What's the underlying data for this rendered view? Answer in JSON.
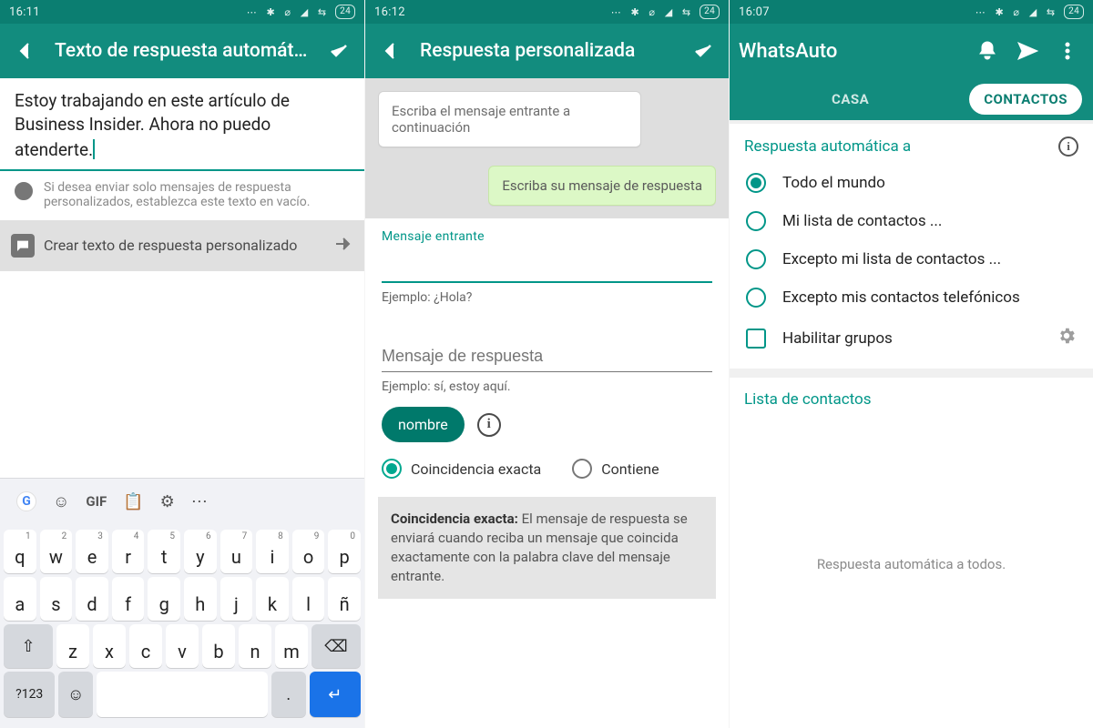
{
  "panel1": {
    "status_time": "16:11",
    "status_icons": "⋯ ✱ ⌀ ◢ ⇆",
    "battery": "24",
    "title": "Texto de respuesta automát…",
    "message": "Estoy trabajando en este artículo de Business Insider. Ahora no puedo atenderte.",
    "hint": "Si desea enviar solo mensajes de respuesta personalizados, establezca este texto en vacío.",
    "create_button": "Crear texto de respuesta personalizado",
    "keyboard": {
      "gif": "GIF",
      "row1": [
        "q",
        "w",
        "e",
        "r",
        "t",
        "y",
        "u",
        "i",
        "o",
        "p"
      ],
      "row1_sup": [
        "1",
        "2",
        "3",
        "4",
        "5",
        "6",
        "7",
        "8",
        "9",
        "0"
      ],
      "row2": [
        "a",
        "s",
        "d",
        "f",
        "g",
        "h",
        "j",
        "k",
        "l",
        "ñ"
      ],
      "row3": [
        "z",
        "x",
        "c",
        "v",
        "b",
        "n",
        "m"
      ],
      "sym": "?123"
    }
  },
  "panel2": {
    "status_time": "16:12",
    "battery": "24",
    "title": "Respuesta personalizada",
    "bubble_in": "Escriba el mensaje entrante a continuación",
    "bubble_out": "Escriba su mensaje de respuesta",
    "section1_title": "Mensaje entrante",
    "example1": "Ejemplo: ¿Hola?",
    "reply_placeholder": "Mensaje de respuesta",
    "example2": "Ejemplo: sí, estoy aquí.",
    "chip": "nombre",
    "radio_exact": "Coincidencia exacta",
    "radio_contains": "Contiene",
    "note_title": "Coincidencia exacta:",
    "note_body": " El mensaje de respuesta se enviará cuando reciba un mensaje que coincida exactamente con la palabra clave del mensaje entrante."
  },
  "panel3": {
    "status_time": "16:07",
    "battery": "24",
    "brand": "WhatsAuto",
    "tab_home": "CASA",
    "tab_contacts": "CONTACTOS",
    "card_title": "Respuesta automática a",
    "options": [
      "Todo el mundo",
      "Mi lista de contactos ...",
      "Excepto mi lista de contactos ...",
      "Excepto mis contactos telefónicos"
    ],
    "enable_groups": "Habilitar grupos",
    "contacts_card_title": "Lista de contactos",
    "empty_text": "Respuesta automática a todos."
  }
}
